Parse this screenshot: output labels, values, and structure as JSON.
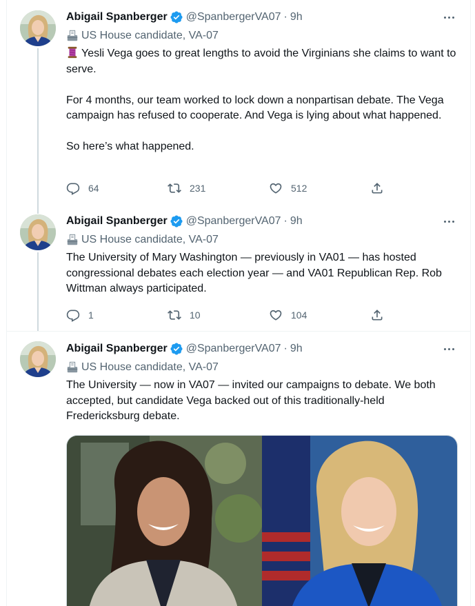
{
  "colors": {
    "accent": "#1d9bf0",
    "muted": "#536471",
    "text": "#0f1419"
  },
  "tweets": [
    {
      "author": "Abigail Spanberger",
      "handle": "@SpanbergerVA07",
      "time": "9h",
      "label": "US House candidate, VA-07",
      "verified_icon": "verified-badge-icon",
      "paragraphs": [
        "Yesli Vega goes to great lengths to avoid the Virginians she claims to want to serve.",
        "For 4 months, our team worked to lock down a nonpartisan debate. The Vega campaign has refused to cooperate. And Vega is lying about what happened.",
        "So here’s what happened."
      ],
      "replies": "64",
      "retweets": "231",
      "likes": "512"
    },
    {
      "author": "Abigail Spanberger",
      "handle": "@SpanbergerVA07",
      "time": "9h",
      "label": "US House candidate, VA-07",
      "text": "The University of Mary Washington — previously in VA01 — has hosted congressional debates each election year — and VA01 Republican Rep. Rob Wittman always participated.",
      "replies": "1",
      "retweets": "10",
      "likes": "104"
    },
    {
      "author": "Abigail Spanberger",
      "handle": "@SpanbergerVA07",
      "time": "9h",
      "label": "US House candidate, VA-07",
      "text": "The University — now in VA07 — invited our campaigns to debate. We both accepted, but candidate Vega backed out of this traditionally-held Fredericksburg debate."
    }
  ],
  "separator": "·"
}
